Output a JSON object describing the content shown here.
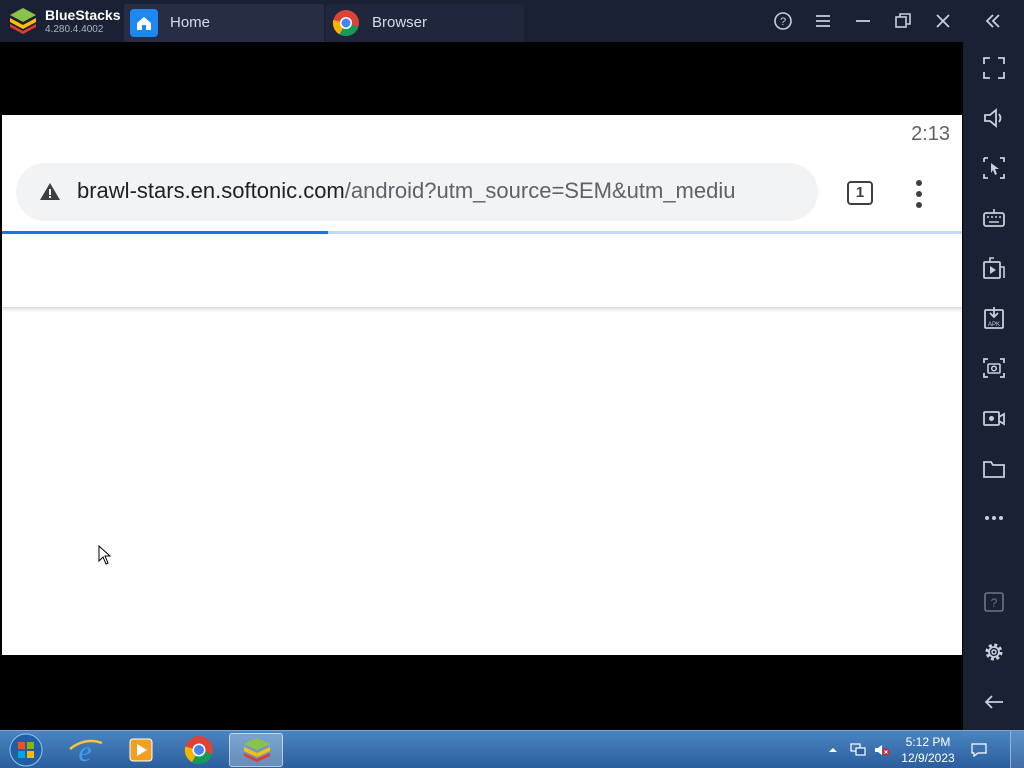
{
  "app": {
    "name": "BlueStacks",
    "version": "4.280.4.4002"
  },
  "tabs": [
    {
      "label": "Home",
      "icon": "home-icon"
    },
    {
      "label": "Browser",
      "icon": "chrome-icon"
    }
  ],
  "titlebar_buttons": [
    "help-icon",
    "menu-icon",
    "minimize-icon",
    "restore-icon",
    "close-icon",
    "collapse-sidebar-icon"
  ],
  "sidebar_icons": [
    "fullscreen-icon",
    "volume-icon",
    "multi-instance-icon",
    "keyboard-icon",
    "media-manager-icon",
    "install-apk-icon",
    "screenshot-icon",
    "record-icon",
    "folder-icon",
    "more-icon",
    "help-icon",
    "settings-icon",
    "back-icon"
  ],
  "android": {
    "status_time": "2:13",
    "url_domain": "brawl-stars.en.softonic.com",
    "url_path": "/android?utm_source=SEM&utm_mediu",
    "tab_count": "1",
    "load_progress": 0.34
  },
  "taskbar": {
    "apps": [
      "internet-explorer-icon",
      "media-player-icon",
      "chrome-icon",
      "bluestacks-icon"
    ],
    "time": "5:12 PM",
    "date": "12/9/2023"
  },
  "colors": {
    "chrome_blue": "#1a73e8",
    "bluestacks_frame": "#1b2135",
    "taskbar": "#2a5e9c"
  }
}
